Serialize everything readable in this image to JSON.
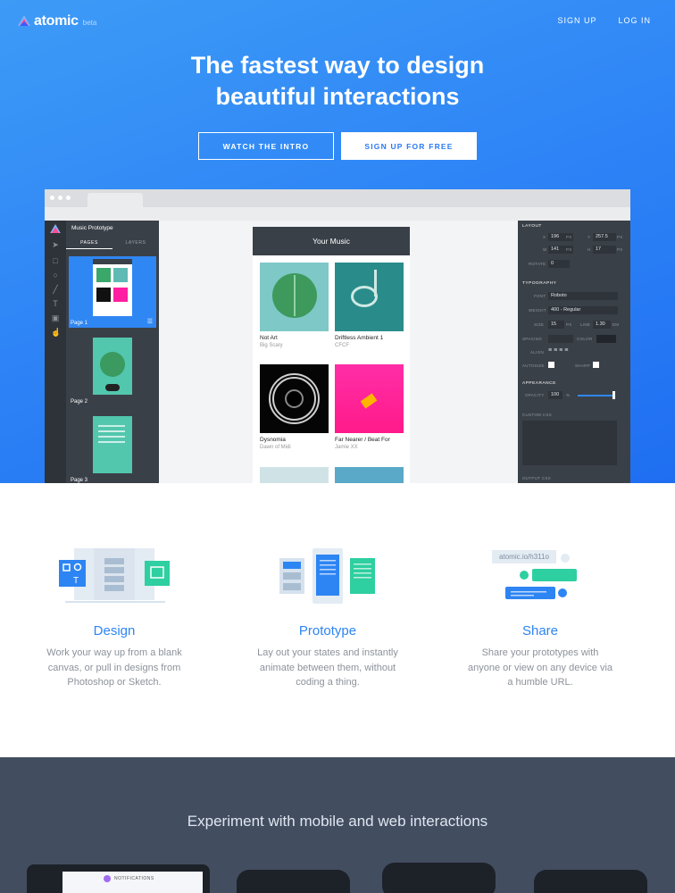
{
  "brand": {
    "name": "atomic",
    "tag": "beta"
  },
  "nav": {
    "signup": "SIGN UP",
    "login": "LOG IN"
  },
  "hero": {
    "title_line1": "The fastest way to design",
    "title_line2": "beautiful interactions",
    "btn_intro": "WATCH THE INTRO",
    "btn_signup": "SIGN UP FOR FREE"
  },
  "editor": {
    "project": "Music Prototype",
    "tabs": [
      "PAGES",
      "LAYERS"
    ],
    "pages": [
      "Page 1",
      "Page 2",
      "Page 3"
    ],
    "app_title": "Your Music",
    "cards": [
      {
        "title": "Not Art",
        "artist": "Big Scary"
      },
      {
        "title": "Driftless Ambient 1",
        "artist": "CFCF"
      },
      {
        "title": "Dysnomia",
        "artist": "Dawn of Midi"
      },
      {
        "title": "Far Nearer / Beat For",
        "artist": "Jamie XX"
      }
    ],
    "inspector": {
      "layout": "LAYOUT",
      "x_label": "X",
      "x": "196",
      "y_label": "Y",
      "y": "257.5",
      "w_label": "W",
      "w": "141",
      "h_label": "H",
      "h": "17",
      "px": "PX",
      "rotate_label": "ROTATE",
      "rotate": "0",
      "typography": "TYPOGRAPHY",
      "font_label": "FONT",
      "font": "Roboto",
      "weight_label": "WEIGHT",
      "weight": "400 - Regular",
      "size_label": "SIZE",
      "size": "15",
      "line_label": "LINE",
      "line": "1.30",
      "em": "EM",
      "spacing_label": "SPACING",
      "color_label": "COLOR",
      "align_label": "ALIGN",
      "autosize_label": "AUTOSIZE",
      "sharp_label": "SHARP",
      "appearance": "APPEARANCE",
      "opacity_label": "OPACITY",
      "opacity": "100",
      "pct": "%",
      "custom_css": "CUSTOM CSS",
      "output_css": "OUTPUT CSS"
    }
  },
  "features": [
    {
      "title": "Design",
      "text": [
        "Work your way up from a blank",
        "canvas, or pull in designs from",
        "Photoshop or Sketch."
      ]
    },
    {
      "title": "Prototype",
      "text": [
        "Lay out your states and instantly",
        "animate between them, without",
        "coding a thing."
      ]
    },
    {
      "title": "Share",
      "text": [
        "Share your prototypes with",
        "anyone or view on any device via",
        "a humble URL."
      ],
      "url": "atomic.io/h311o"
    }
  ],
  "bottom": {
    "title": "Experiment with mobile and web interactions",
    "notifications": "NOTIFICATIONS"
  },
  "colors": {
    "accent": "#2d85f3",
    "hero_top": "#3d9bf6",
    "hero_bottom": "#1f6ef2",
    "footer_bg": "#424d60",
    "editor_dark": "#3a4048",
    "teal": "#2ecfa0"
  }
}
